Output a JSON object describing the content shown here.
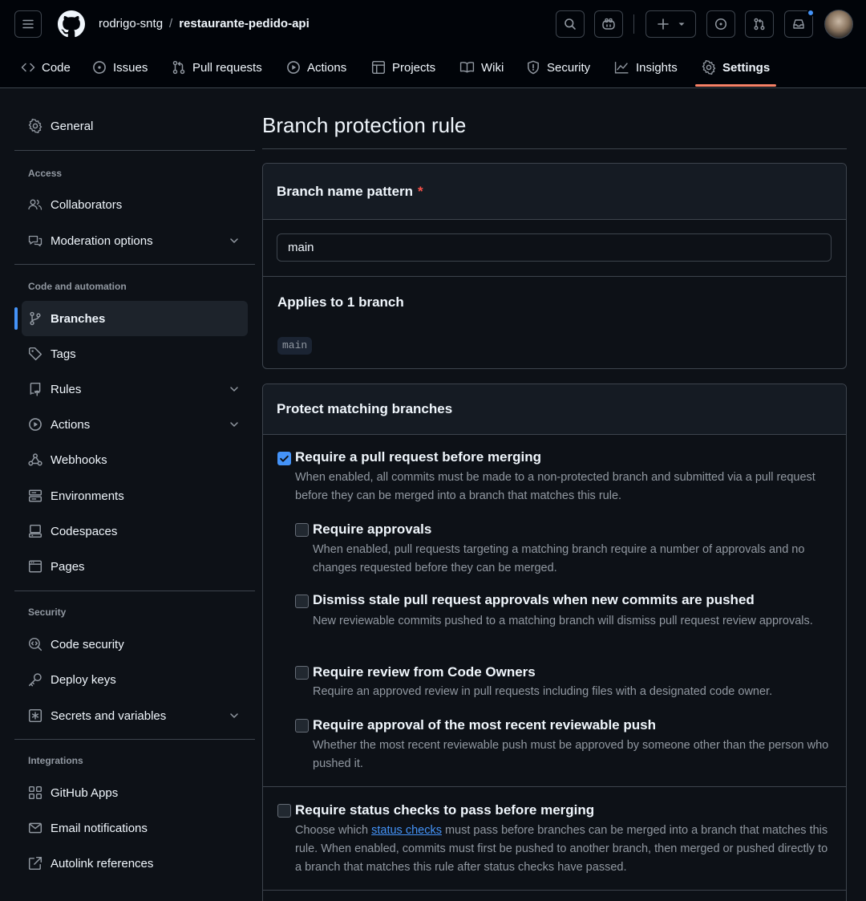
{
  "header": {
    "owner": "rodrigo-sntg",
    "separator": "/",
    "repo": "restaurante-pedido-api",
    "icons": [
      "menu-icon",
      "github-logo-icon",
      "search-icon",
      "copilot-icon",
      "plus-icon",
      "triangle-down-icon",
      "issue-icon",
      "pull-request-icon",
      "inbox-icon"
    ]
  },
  "tabs": [
    {
      "label": "Code",
      "icon": "code-icon"
    },
    {
      "label": "Issues",
      "icon": "issue-icon"
    },
    {
      "label": "Pull requests",
      "icon": "pull-request-icon"
    },
    {
      "label": "Actions",
      "icon": "play-icon"
    },
    {
      "label": "Projects",
      "icon": "table-icon"
    },
    {
      "label": "Wiki",
      "icon": "book-icon"
    },
    {
      "label": "Security",
      "icon": "shield-icon"
    },
    {
      "label": "Insights",
      "icon": "graph-icon"
    },
    {
      "label": "Settings",
      "icon": "gear-icon",
      "active": true
    }
  ],
  "sidebar": {
    "general": "General",
    "headings": {
      "access": "Access",
      "code": "Code and automation",
      "security": "Security",
      "integrations": "Integrations"
    },
    "items": {
      "collaborators": "Collaborators",
      "moderation": "Moderation options",
      "branches": "Branches",
      "tags": "Tags",
      "rules": "Rules",
      "actions": "Actions",
      "webhooks": "Webhooks",
      "environments": "Environments",
      "codespaces": "Codespaces",
      "pages": "Pages",
      "code_security": "Code security",
      "deploy_keys": "Deploy keys",
      "secrets": "Secrets and variables",
      "github_apps": "GitHub Apps",
      "email": "Email notifications",
      "autolink": "Autolink references"
    }
  },
  "main": {
    "title": "Branch protection rule",
    "pattern_box": {
      "title": "Branch name pattern",
      "required_mark": "*",
      "value": "main",
      "applies_title": "Applies to 1 branch",
      "branch_chip": "main"
    },
    "protect_box": {
      "title": "Protect matching branches",
      "options": [
        {
          "label": "Require a pull request before merging",
          "checked": true,
          "desc": "When enabled, all commits must be made to a non-protected branch and submitted via a pull request before they can be merged into a branch that matches this rule."
        },
        {
          "label": "Require approvals",
          "checked": false,
          "desc": "When enabled, pull requests targeting a matching branch require a number of approvals and no changes requested before they can be merged."
        },
        {
          "label": "Dismiss stale pull request approvals when new commits are pushed",
          "checked": false,
          "desc": "New reviewable commits pushed to a matching branch will dismiss pull request review approvals."
        },
        {
          "label": "Require review from Code Owners",
          "checked": false,
          "desc": "Require an approved review in pull requests including files with a designated code owner."
        },
        {
          "label": "Require approval of the most recent reviewable push",
          "checked": false,
          "desc": "Whether the most recent reviewable push must be approved by someone other than the person who pushed it."
        },
        {
          "label": "Require status checks to pass before merging",
          "checked": false,
          "desc_pre": "Choose which ",
          "desc_link": "status checks",
          "desc_post": " must pass before branches can be merged into a branch that matches this rule. When enabled, commits must first be pushed to another branch, then merged or pushed directly to a branch that matches this rule after status checks have passed."
        }
      ]
    }
  },
  "colors": {
    "background": "#0d1117",
    "header_bg": "#010409",
    "border": "#3d444d",
    "accent_blue": "#4493f8",
    "tab_underline": "#f78166",
    "required": "#f85149"
  }
}
